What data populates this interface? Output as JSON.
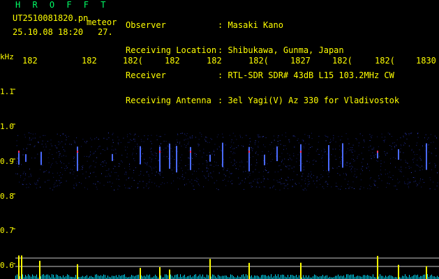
{
  "header": {
    "title": "H R O F F T",
    "filename": "UT2510081820.pn",
    "filename_suffix": "meteor",
    "datetime": "25.10.08 18:20",
    "count": "27."
  },
  "info": [
    {
      "label": "Observer",
      "value": ": Masaki Kano"
    },
    {
      "label": "Receiving Location",
      "value": ": Shibukawa, Gunma, Japan"
    },
    {
      "label": "Receiver",
      "value": ": RTL-SDR SDR# 43dB L15 103.2MHz CW"
    },
    {
      "label": "Receiving Antenna",
      "value": ": 3el Yagi(V) Az 330 for Vladivostok"
    }
  ],
  "time_axis": {
    "ticks": [
      "182",
      "182",
      "182(",
      "182",
      "182",
      "182(",
      "1827",
      "182(",
      "182(",
      "1830"
    ]
  },
  "freq_axis": {
    "unit": "kHz",
    "ticks": [
      "1.1",
      "1.0",
      "0.9",
      "0.8",
      "0.7",
      "0.6"
    ]
  },
  "colors": {
    "text": "#ffff00",
    "title": "#00ff66",
    "background": "#000000",
    "signal": "#1a2a9a",
    "trace": "#ffff00",
    "trace2": "#00e0ff"
  }
}
